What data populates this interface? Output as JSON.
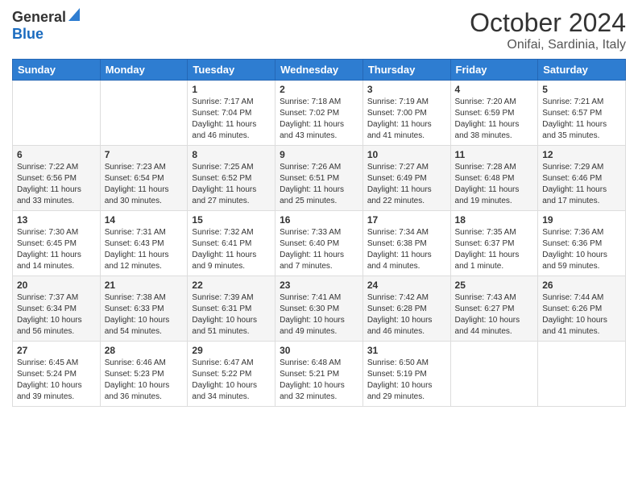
{
  "header": {
    "logo_line1": "General",
    "logo_line2": "Blue",
    "month": "October 2024",
    "location": "Onifai, Sardinia, Italy"
  },
  "weekdays": [
    "Sunday",
    "Monday",
    "Tuesday",
    "Wednesday",
    "Thursday",
    "Friday",
    "Saturday"
  ],
  "weeks": [
    [
      {
        "day": "",
        "info": ""
      },
      {
        "day": "",
        "info": ""
      },
      {
        "day": "1",
        "info": "Sunrise: 7:17 AM\nSunset: 7:04 PM\nDaylight: 11 hours and 46 minutes."
      },
      {
        "day": "2",
        "info": "Sunrise: 7:18 AM\nSunset: 7:02 PM\nDaylight: 11 hours and 43 minutes."
      },
      {
        "day": "3",
        "info": "Sunrise: 7:19 AM\nSunset: 7:00 PM\nDaylight: 11 hours and 41 minutes."
      },
      {
        "day": "4",
        "info": "Sunrise: 7:20 AM\nSunset: 6:59 PM\nDaylight: 11 hours and 38 minutes."
      },
      {
        "day": "5",
        "info": "Sunrise: 7:21 AM\nSunset: 6:57 PM\nDaylight: 11 hours and 35 minutes."
      }
    ],
    [
      {
        "day": "6",
        "info": "Sunrise: 7:22 AM\nSunset: 6:56 PM\nDaylight: 11 hours and 33 minutes."
      },
      {
        "day": "7",
        "info": "Sunrise: 7:23 AM\nSunset: 6:54 PM\nDaylight: 11 hours and 30 minutes."
      },
      {
        "day": "8",
        "info": "Sunrise: 7:25 AM\nSunset: 6:52 PM\nDaylight: 11 hours and 27 minutes."
      },
      {
        "day": "9",
        "info": "Sunrise: 7:26 AM\nSunset: 6:51 PM\nDaylight: 11 hours and 25 minutes."
      },
      {
        "day": "10",
        "info": "Sunrise: 7:27 AM\nSunset: 6:49 PM\nDaylight: 11 hours and 22 minutes."
      },
      {
        "day": "11",
        "info": "Sunrise: 7:28 AM\nSunset: 6:48 PM\nDaylight: 11 hours and 19 minutes."
      },
      {
        "day": "12",
        "info": "Sunrise: 7:29 AM\nSunset: 6:46 PM\nDaylight: 11 hours and 17 minutes."
      }
    ],
    [
      {
        "day": "13",
        "info": "Sunrise: 7:30 AM\nSunset: 6:45 PM\nDaylight: 11 hours and 14 minutes."
      },
      {
        "day": "14",
        "info": "Sunrise: 7:31 AM\nSunset: 6:43 PM\nDaylight: 11 hours and 12 minutes."
      },
      {
        "day": "15",
        "info": "Sunrise: 7:32 AM\nSunset: 6:41 PM\nDaylight: 11 hours and 9 minutes."
      },
      {
        "day": "16",
        "info": "Sunrise: 7:33 AM\nSunset: 6:40 PM\nDaylight: 11 hours and 7 minutes."
      },
      {
        "day": "17",
        "info": "Sunrise: 7:34 AM\nSunset: 6:38 PM\nDaylight: 11 hours and 4 minutes."
      },
      {
        "day": "18",
        "info": "Sunrise: 7:35 AM\nSunset: 6:37 PM\nDaylight: 11 hours and 1 minute."
      },
      {
        "day": "19",
        "info": "Sunrise: 7:36 AM\nSunset: 6:36 PM\nDaylight: 10 hours and 59 minutes."
      }
    ],
    [
      {
        "day": "20",
        "info": "Sunrise: 7:37 AM\nSunset: 6:34 PM\nDaylight: 10 hours and 56 minutes."
      },
      {
        "day": "21",
        "info": "Sunrise: 7:38 AM\nSunset: 6:33 PM\nDaylight: 10 hours and 54 minutes."
      },
      {
        "day": "22",
        "info": "Sunrise: 7:39 AM\nSunset: 6:31 PM\nDaylight: 10 hours and 51 minutes."
      },
      {
        "day": "23",
        "info": "Sunrise: 7:41 AM\nSunset: 6:30 PM\nDaylight: 10 hours and 49 minutes."
      },
      {
        "day": "24",
        "info": "Sunrise: 7:42 AM\nSunset: 6:28 PM\nDaylight: 10 hours and 46 minutes."
      },
      {
        "day": "25",
        "info": "Sunrise: 7:43 AM\nSunset: 6:27 PM\nDaylight: 10 hours and 44 minutes."
      },
      {
        "day": "26",
        "info": "Sunrise: 7:44 AM\nSunset: 6:26 PM\nDaylight: 10 hours and 41 minutes."
      }
    ],
    [
      {
        "day": "27",
        "info": "Sunrise: 6:45 AM\nSunset: 5:24 PM\nDaylight: 10 hours and 39 minutes."
      },
      {
        "day": "28",
        "info": "Sunrise: 6:46 AM\nSunset: 5:23 PM\nDaylight: 10 hours and 36 minutes."
      },
      {
        "day": "29",
        "info": "Sunrise: 6:47 AM\nSunset: 5:22 PM\nDaylight: 10 hours and 34 minutes."
      },
      {
        "day": "30",
        "info": "Sunrise: 6:48 AM\nSunset: 5:21 PM\nDaylight: 10 hours and 32 minutes."
      },
      {
        "day": "31",
        "info": "Sunrise: 6:50 AM\nSunset: 5:19 PM\nDaylight: 10 hours and 29 minutes."
      },
      {
        "day": "",
        "info": ""
      },
      {
        "day": "",
        "info": ""
      }
    ]
  ]
}
